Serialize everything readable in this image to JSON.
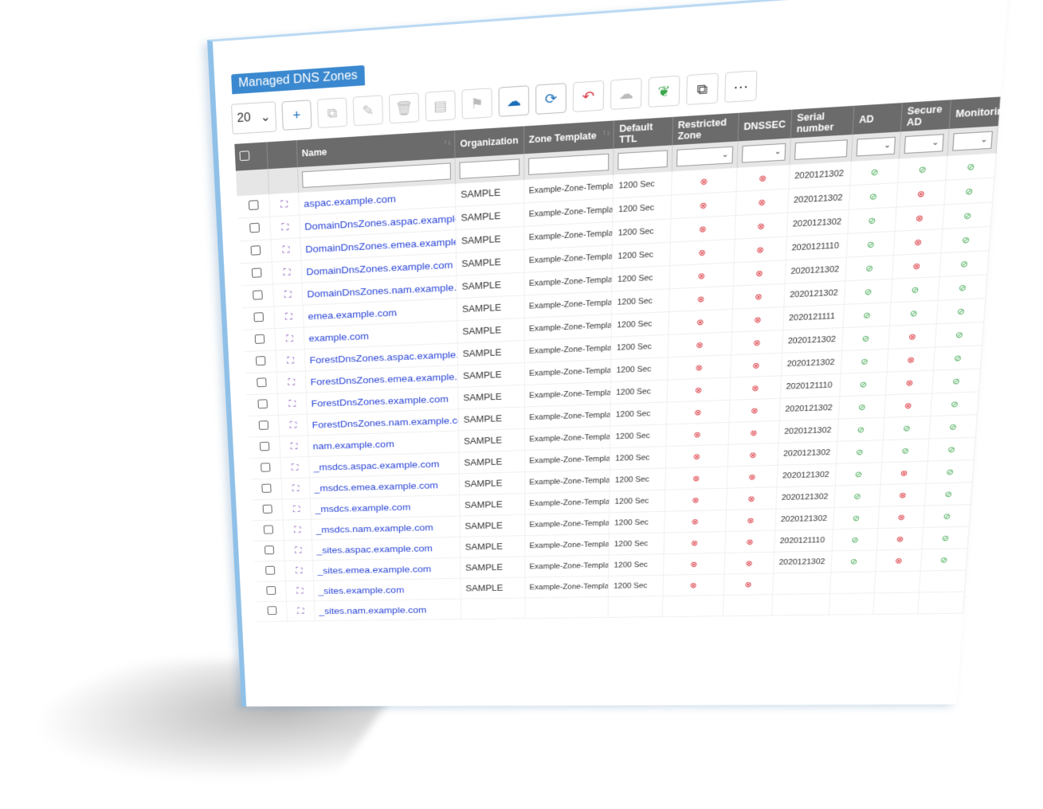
{
  "panel": {
    "tab_title": "Managed DNS Zones"
  },
  "toolbar": {
    "page_size": "20",
    "page_size_caret": "⌄",
    "icons": {
      "add": "+",
      "copy": "⧉",
      "edit": "✎",
      "delete": "🗑",
      "document": "▤",
      "bookmark": "⚑",
      "upload": "☁",
      "refresh": "⟳",
      "undo": "↶",
      "cloud": "☁",
      "leaf": "❦",
      "clone": "⧉",
      "more": "⋯"
    }
  },
  "columns": {
    "name": "Name",
    "organization": "Organization",
    "zone_template": "Zone Template",
    "default_ttl": "Default TTL",
    "restricted_zone": "Restricted Zone",
    "dnssec": "DNSSEC",
    "serial_number": "Serial number",
    "ad": "AD",
    "secure_ad": "Secure AD",
    "monitoring": "Monitoring",
    "sort_glyph": "↑↓",
    "filter_caret": "⌄"
  },
  "glyphs": {
    "no": "⊗",
    "yes": "⊘",
    "zone": "⛶"
  },
  "rows": [
    {
      "name": "aspac.example.com",
      "org": "SAMPLE",
      "tmpl": "Example-Zone-Template",
      "ttl": "1200 Sec",
      "serial": "2020121302",
      "ad": "yes",
      "sad": "yes",
      "mon": "yes"
    },
    {
      "name": "DomainDnsZones.aspac.example.com",
      "org": "SAMPLE",
      "tmpl": "Example-Zone-Template",
      "ttl": "1200 Sec",
      "serial": "2020121302",
      "ad": "yes",
      "sad": "no",
      "mon": "yes"
    },
    {
      "name": "DomainDnsZones.emea.example.com",
      "org": "SAMPLE",
      "tmpl": "Example-Zone-Template",
      "ttl": "1200 Sec",
      "serial": "2020121302",
      "ad": "yes",
      "sad": "no",
      "mon": "yes"
    },
    {
      "name": "DomainDnsZones.example.com",
      "org": "SAMPLE",
      "tmpl": "Example-Zone-Template",
      "ttl": "1200 Sec",
      "serial": "2020121110",
      "ad": "yes",
      "sad": "no",
      "mon": "yes"
    },
    {
      "name": "DomainDnsZones.nam.example.com",
      "org": "SAMPLE",
      "tmpl": "Example-Zone-Template",
      "ttl": "1200 Sec",
      "serial": "2020121302",
      "ad": "yes",
      "sad": "no",
      "mon": "yes"
    },
    {
      "name": "emea.example.com",
      "org": "SAMPLE",
      "tmpl": "Example-Zone-Template",
      "ttl": "1200 Sec",
      "serial": "2020121302",
      "ad": "yes",
      "sad": "yes",
      "mon": "yes"
    },
    {
      "name": "example.com",
      "org": "SAMPLE",
      "tmpl": "Example-Zone-Template",
      "ttl": "1200 Sec",
      "serial": "2020121111",
      "ad": "yes",
      "sad": "yes",
      "mon": "yes"
    },
    {
      "name": "ForestDnsZones.aspac.example.com",
      "org": "SAMPLE",
      "tmpl": "Example-Zone-Template",
      "ttl": "1200 Sec",
      "serial": "2020121302",
      "ad": "yes",
      "sad": "no",
      "mon": "yes"
    },
    {
      "name": "ForestDnsZones.emea.example.com",
      "org": "SAMPLE",
      "tmpl": "Example-Zone-Template",
      "ttl": "1200 Sec",
      "serial": "2020121302",
      "ad": "yes",
      "sad": "no",
      "mon": "yes"
    },
    {
      "name": "ForestDnsZones.example.com",
      "org": "SAMPLE",
      "tmpl": "Example-Zone-Template",
      "ttl": "1200 Sec",
      "serial": "2020121110",
      "ad": "yes",
      "sad": "no",
      "mon": "yes"
    },
    {
      "name": "ForestDnsZones.nam.example.com",
      "org": "SAMPLE",
      "tmpl": "Example-Zone-Template",
      "ttl": "1200 Sec",
      "serial": "2020121302",
      "ad": "yes",
      "sad": "no",
      "mon": "yes"
    },
    {
      "name": "nam.example.com",
      "org": "SAMPLE",
      "tmpl": "Example-Zone-Template",
      "ttl": "1200 Sec",
      "serial": "2020121302",
      "ad": "yes",
      "sad": "yes",
      "mon": "yes"
    },
    {
      "name": "_msdcs.aspac.example.com",
      "org": "SAMPLE",
      "tmpl": "Example-Zone-Template",
      "ttl": "1200 Sec",
      "serial": "2020121302",
      "ad": "yes",
      "sad": "yes",
      "mon": "yes"
    },
    {
      "name": "_msdcs.emea.example.com",
      "org": "SAMPLE",
      "tmpl": "Example-Zone-Template",
      "ttl": "1200 Sec",
      "serial": "2020121302",
      "ad": "yes",
      "sad": "no",
      "mon": "yes"
    },
    {
      "name": "_msdcs.example.com",
      "org": "SAMPLE",
      "tmpl": "Example-Zone-Template",
      "ttl": "1200 Sec",
      "serial": "2020121302",
      "ad": "yes",
      "sad": "no",
      "mon": "yes"
    },
    {
      "name": "_msdcs.nam.example.com",
      "org": "SAMPLE",
      "tmpl": "Example-Zone-Template",
      "ttl": "1200 Sec",
      "serial": "2020121302",
      "ad": "yes",
      "sad": "no",
      "mon": "yes"
    },
    {
      "name": "_sites.aspac.example.com",
      "org": "SAMPLE",
      "tmpl": "Example-Zone-Template",
      "ttl": "1200 Sec",
      "serial": "2020121110",
      "ad": "yes",
      "sad": "no",
      "mon": "yes"
    },
    {
      "name": "_sites.emea.example.com",
      "org": "SAMPLE",
      "tmpl": "Example-Zone-Template",
      "ttl": "1200 Sec",
      "serial": "2020121302",
      "ad": "yes",
      "sad": "no",
      "mon": "yes"
    },
    {
      "name": "_sites.example.com",
      "org": "SAMPLE",
      "tmpl": "Example-Zone-Template",
      "ttl": "1200 Sec",
      "serial": "",
      "ad": "",
      "sad": "",
      "mon": ""
    },
    {
      "name": "_sites.nam.example.com",
      "org": "",
      "tmpl": "",
      "ttl": "",
      "serial": "",
      "ad": "",
      "sad": "",
      "mon": ""
    }
  ]
}
